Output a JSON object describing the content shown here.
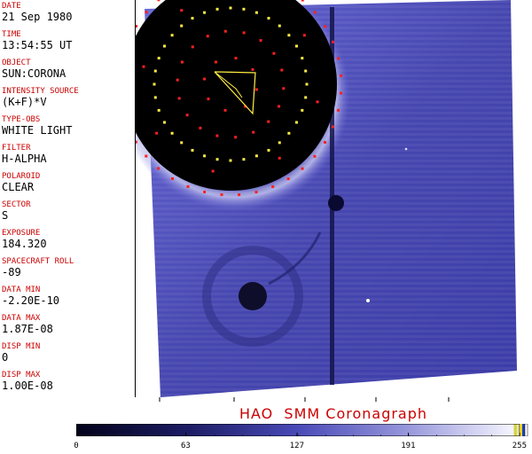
{
  "metadata": {
    "fields": [
      {
        "label": "DATE",
        "value": "21 Sep 1980"
      },
      {
        "label": "TIME",
        "value": "13:54:55 UT"
      },
      {
        "label": "OBJECT",
        "value": "SUN:CORONA"
      },
      {
        "label": "INTENSITY SOURCE",
        "value": "(K+F)*V"
      },
      {
        "label": "TYPE-OBS",
        "value": "WHITE LIGHT"
      },
      {
        "label": "FILTER",
        "value": "H-ALPHA"
      },
      {
        "label": "POLAROID",
        "value": "CLEAR"
      },
      {
        "label": "SECTOR",
        "value": "S"
      },
      {
        "label": "EXPOSURE",
        "value": "184.320"
      },
      {
        "label": "SPACECRAFT ROLL",
        "value": "-89"
      },
      {
        "label": "DATA MIN",
        "value": "-2.20E-10"
      },
      {
        "label": "DATA MAX",
        "value": "1.87E-08"
      },
      {
        "label": "DISP MIN",
        "value": "0"
      },
      {
        "label": "DISP MAX",
        "value": "1.00E-08"
      }
    ]
  },
  "caption": "HAO  SMM Coronagraph",
  "colorbar": {
    "tick_labels": [
      "0",
      "63",
      "127",
      "191",
      "255"
    ],
    "colors": {
      "dark": "#02021a",
      "mid": "#3a3aa0",
      "light": "#ffffff"
    }
  },
  "colors": {
    "label_red": "#cc0000",
    "occulter_black": "#000000",
    "corona_blue": "#4a4ab8",
    "overlay_red": "#ff2020",
    "overlay_yellow": "#ffee44"
  }
}
